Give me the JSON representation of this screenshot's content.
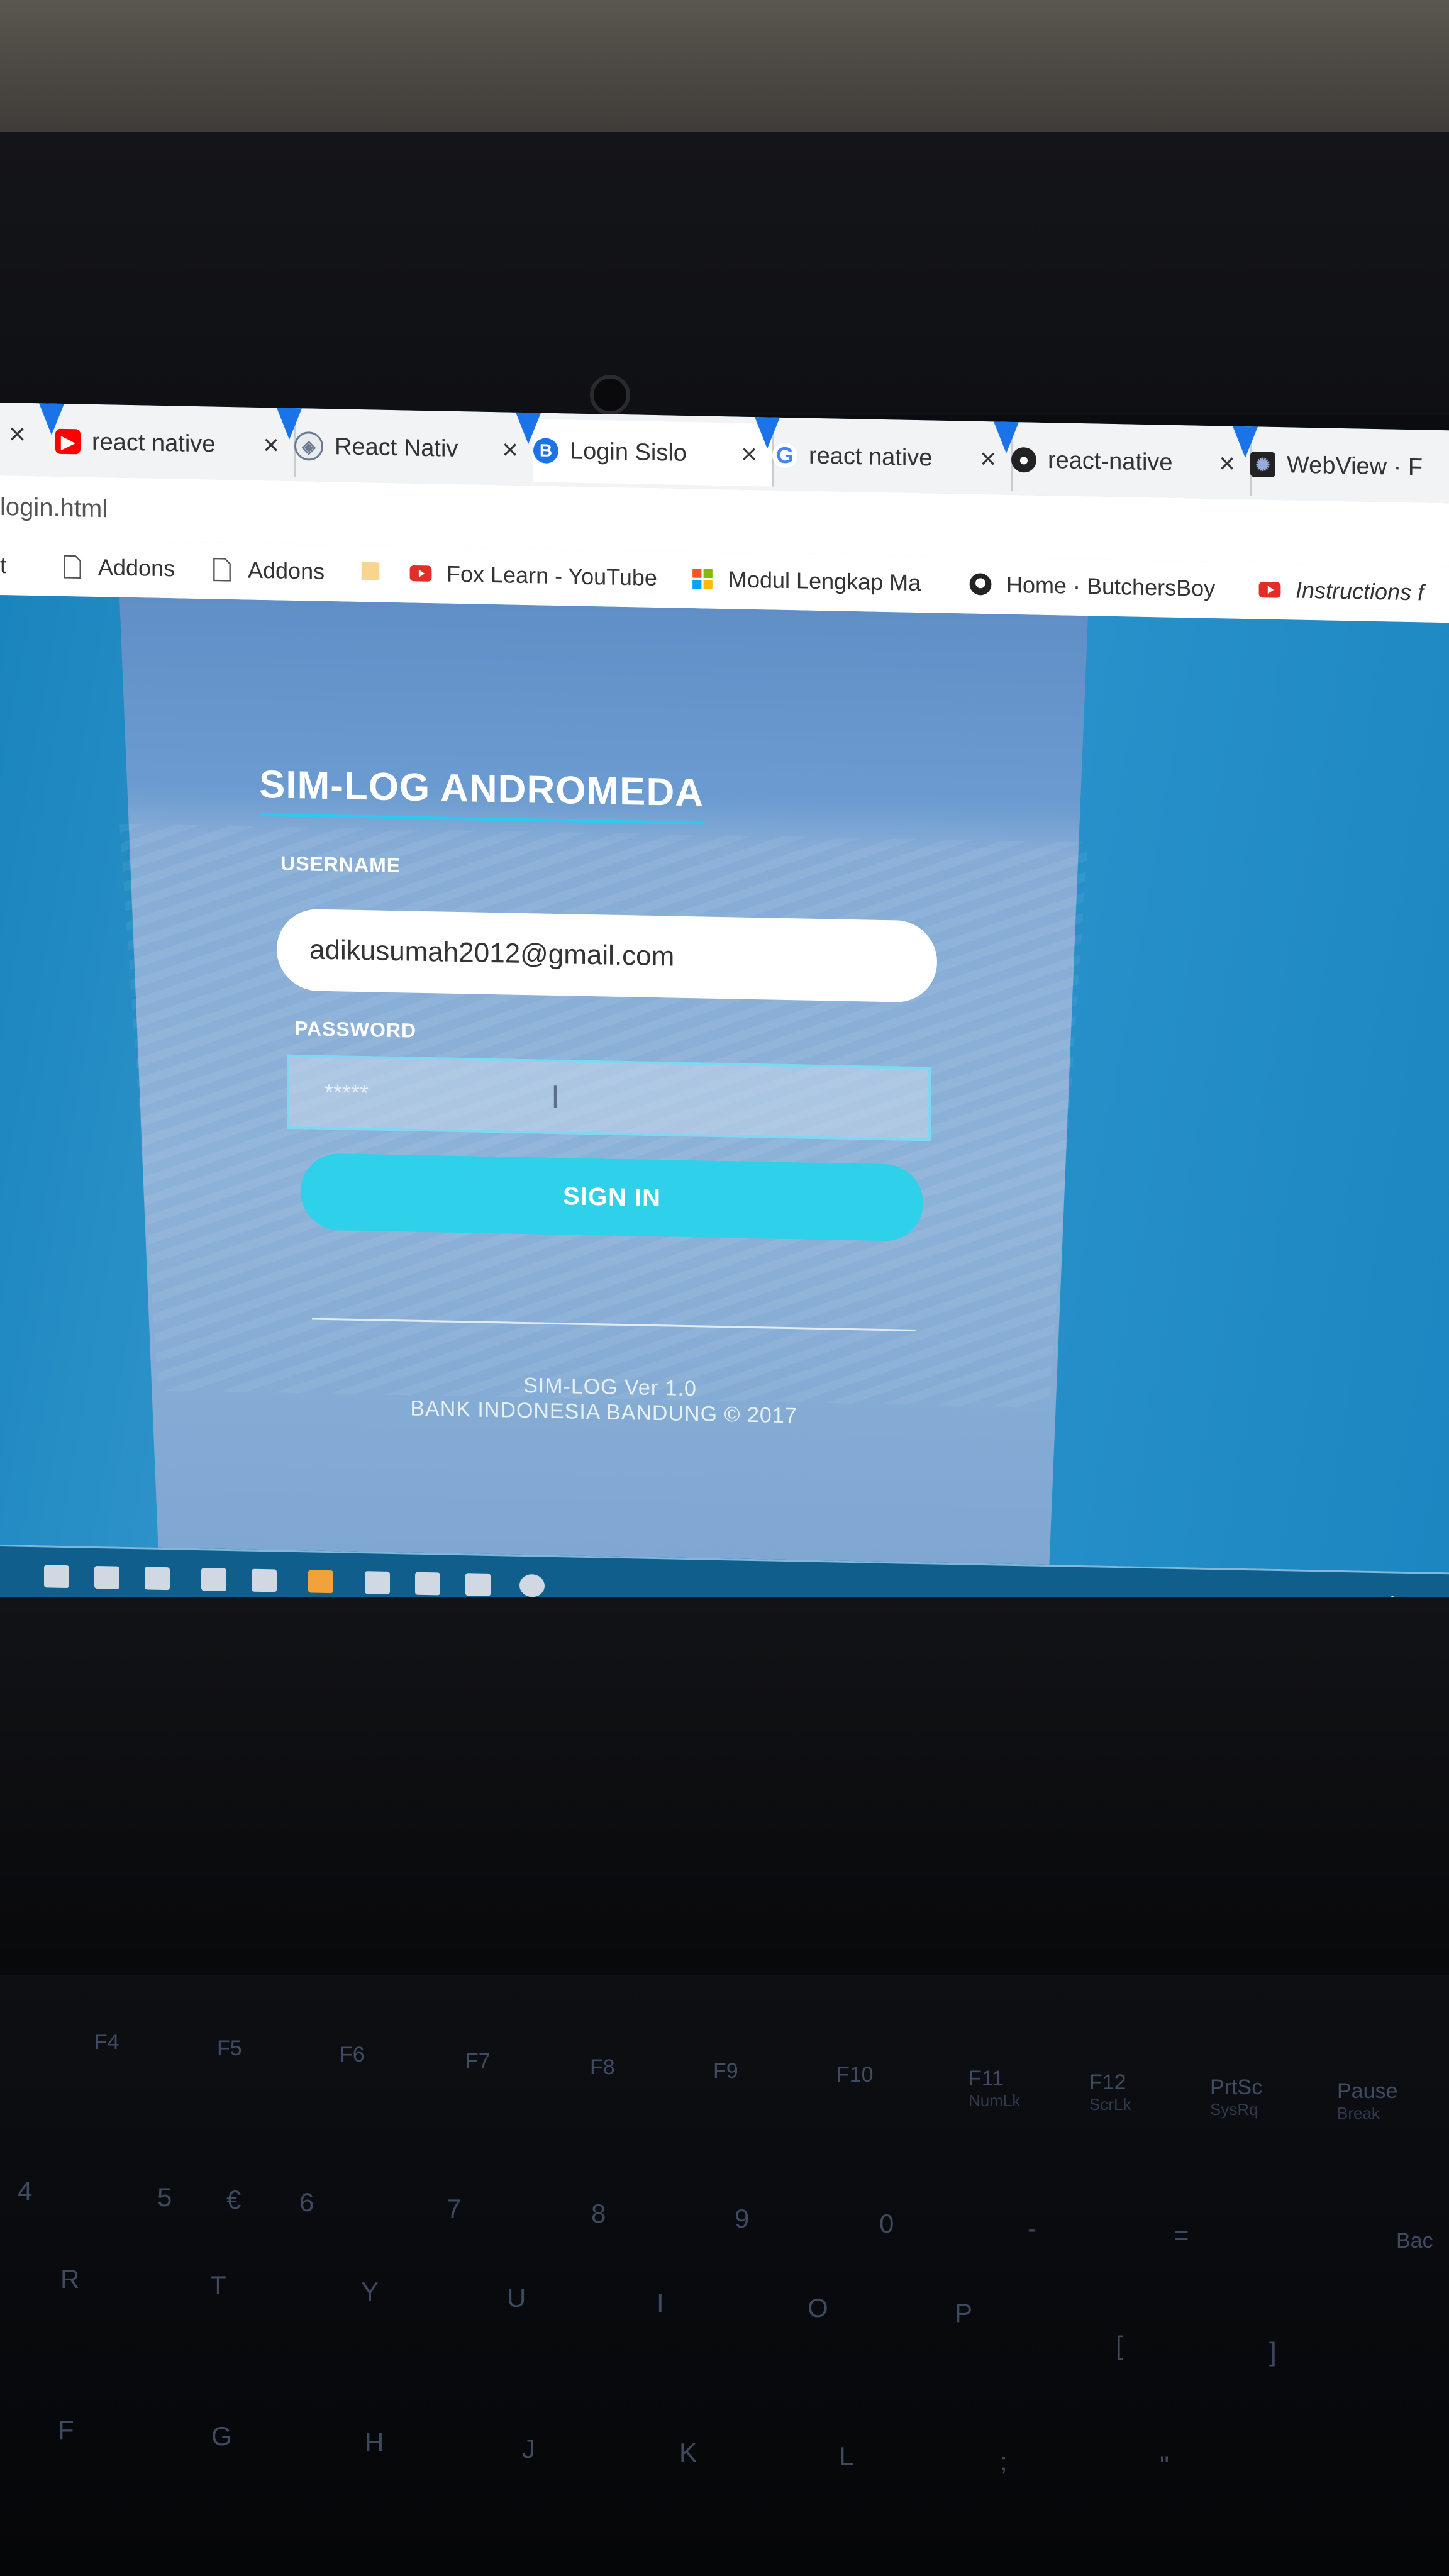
{
  "browser": {
    "tabs": [
      {
        "title": "react native",
        "icon": "youtube-icon",
        "color": "#ff0000"
      },
      {
        "title": "React Nativ",
        "icon": "react-native-icon",
        "color": "#6b7a8f"
      },
      {
        "title": "Login Sislo",
        "icon": "bootstrap-icon",
        "color": "#1a73e8",
        "active": true
      },
      {
        "title": "react native",
        "icon": "google-icon",
        "color": "#4285f4"
      },
      {
        "title": "react-native",
        "icon": "github-icon",
        "color": "#222222"
      },
      {
        "title": "WebView · F",
        "icon": "react-icon",
        "color": "#222222"
      }
    ],
    "close_glyph": "×",
    "url": "login.html",
    "bookmarks": [
      {
        "label": "Addons",
        "icon": "page-icon"
      },
      {
        "label": "Addons",
        "icon": "page-icon"
      },
      {
        "label": "",
        "icon": "folder-icon"
      },
      {
        "label": "Fox Learn - YouTube",
        "icon": "youtube-icon"
      },
      {
        "label": "Modul Lengkap Ma",
        "icon": "windows-icon"
      },
      {
        "label": "Home · ButchersBoy",
        "icon": "github-icon"
      },
      {
        "label": "Instructions f",
        "icon": "youtube-icon"
      }
    ]
  },
  "login": {
    "title": "SIM-LOG ANDROMEDA",
    "username_label": "USERNAME",
    "username_value": "adikusumah2012@gmail.com",
    "password_label": "PASSWORD",
    "password_value": "*****",
    "signin_label": "SIGN IN",
    "footer_version": "SIM-LOG Ver 1.0",
    "footer_org": "BANK INDONESIA BANDUNG © 2017"
  },
  "keyboard": {
    "fn_keys": [
      "F4",
      "F5",
      "F6",
      "F7",
      "F8",
      "F9",
      "F10",
      "F11",
      "F12",
      "PrtSc",
      "Pause"
    ],
    "fn_sub": [
      "",
      "",
      "",
      "",
      "",
      "",
      "",
      "NumLk",
      "ScrLk",
      "SysRq",
      "Break"
    ],
    "row1": [
      "4",
      "5",
      "€",
      "6",
      "7",
      "8",
      "9",
      "0",
      "-",
      "=",
      "Bac"
    ],
    "row2": [
      "R",
      "T",
      "Y",
      "U",
      "I",
      "O",
      "P",
      "[",
      "]"
    ],
    "row3": [
      "F",
      "G",
      "H",
      "J",
      "K",
      "L",
      ";",
      "\""
    ]
  },
  "colors": {
    "accent": "#2ed0ea",
    "page_bg": "#2b93cc",
    "card": "#86acd6"
  }
}
